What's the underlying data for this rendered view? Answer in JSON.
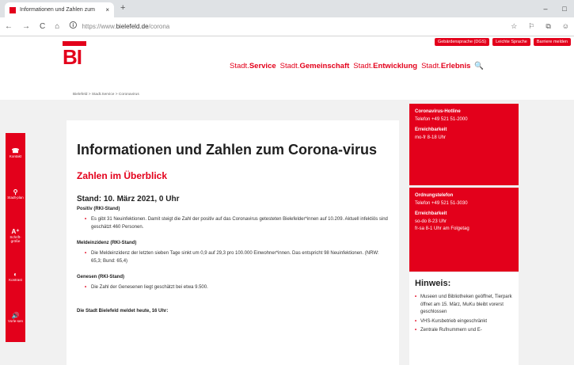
{
  "browser": {
    "tab_title": "Informationen und Zahlen zum",
    "tab_close": "×",
    "new_tab": "+",
    "url_prefix": "https://www.",
    "url_host": "bielefeld.de",
    "url_path": "/corona",
    "back": "←",
    "forward": "→",
    "reload": "C",
    "home": "⌂",
    "lock": "🛈",
    "actions": [
      "☆",
      "⚐",
      "⧉",
      "☺"
    ],
    "window_controls": [
      "–",
      "□"
    ]
  },
  "header": {
    "logo": "BI",
    "toplinks": [
      "Gebärdensprache (DGS)",
      "Leichte Sprache",
      "Barriere melden"
    ],
    "nav": [
      {
        "prefix": "Stadt.",
        "label": "Service"
      },
      {
        "prefix": "Stadt.",
        "label": "Gemeinschaft"
      },
      {
        "prefix": "Stadt.",
        "label": "Entwicklung"
      },
      {
        "prefix": "Stadt.",
        "label": "Erlebnis"
      }
    ],
    "search_icon": "🔍"
  },
  "breadcrumb": "Bielefeld > Stadt.Service > Coronavirus",
  "sidebar": [
    {
      "icon": "phone-icon",
      "glyph": "☎",
      "label": "Kontakt"
    },
    {
      "icon": "map-pin-icon",
      "glyph": "⚲",
      "label": "Stadt-plan"
    },
    {
      "icon": "font-size-icon",
      "glyph": "A⁺",
      "label": "Schrift-größe"
    },
    {
      "icon": "contrast-icon",
      "glyph": "◐",
      "label": "Kontrast"
    },
    {
      "icon": "speaker-icon",
      "glyph": "🔊",
      "label": "Vorle-sen"
    }
  ],
  "main": {
    "title": "Informationen und Zahlen zum Corona-virus",
    "subtitle": "Zahlen im Überblick",
    "stand": "Stand: 10. März 2021, 0 Uhr",
    "sections": [
      {
        "label": "Positiv (RKI-Stand)",
        "text": "Es gibt 31 Neuinfektionen. Damit steigt die Zahl der positiv auf das Coronavirus getesteten Bielefelder*innen auf 10.209. Aktuell infektiös sind geschätzt 460 Personen."
      },
      {
        "label": "Meldeinzidenz (RKI-Stand)",
        "text": "Die Meldeinzidenz der letzten sieben Tage sinkt um 0,9 auf 29,3 pro 100.000 Einwohner*innen. Das entspricht 98 Neuinfektionen. (NRW: 65,3; Bund: 65,4)"
      },
      {
        "label": "Genesen (RKI-Stand)",
        "text": "Die Zahl der Genesenen liegt geschätzt bei etwa 9.500."
      }
    ],
    "footer_line": "Die Stadt Bielefeld meldet heute, 16 Uhr:"
  },
  "hotline": {
    "title": "Coronavirus-Hotline",
    "phone": "Telefon +49 521 51-2000",
    "reach_label": "Erreichbarkeit",
    "hours": [
      "mo-fr 8-18 Uhr"
    ]
  },
  "ordnung": {
    "title": "Ordnungstelefon",
    "phone": "Telefon +49 521 51-3030",
    "reach_label": "Erreichbarkeit",
    "hours": [
      "so-do 8-23 Uhr",
      "fr-sa 8-1 Uhr am Folgetag"
    ]
  },
  "hinweis": {
    "title": "Hinweis:",
    "items": [
      "Museen und Bibliotheken geöffnet, Tierpark öffnet am 15. März, MuKu bleibt vorerst geschlossen",
      "VHS-Kursbetrieb eingeschränkt",
      "Zentrale Rufnummern und E-"
    ]
  },
  "colors": {
    "accent": "#e3001b"
  }
}
